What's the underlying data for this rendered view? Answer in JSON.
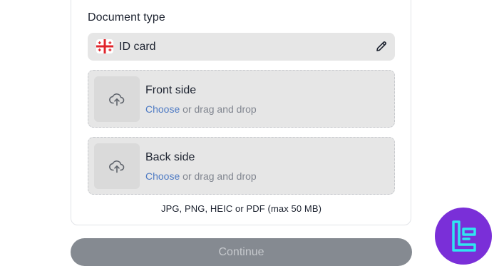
{
  "document": {
    "section_title": "Document type",
    "selected_type": "ID card",
    "flag_icon": "georgia-flag-icon",
    "edit_icon": "pencil-icon"
  },
  "upload": {
    "front": {
      "title": "Front side",
      "choose_label": "Choose",
      "drag_label": " or drag and drop",
      "icon": "cloud-upload-icon"
    },
    "back": {
      "title": "Back side",
      "choose_label": "Choose",
      "drag_label": " or drag and drop",
      "icon": "cloud-upload-icon"
    },
    "formats_note": "JPG, PNG, HEIC or PDF (max 50 MB)"
  },
  "actions": {
    "continue_label": "Continue"
  },
  "colors": {
    "accent_link": "#4f7bc4",
    "button_disabled_bg": "#858a91",
    "button_disabled_text": "#c6c9cd",
    "dropzone_bg": "#e6e6e6",
    "logo_purple": "#7a2fd8",
    "logo_cyan": "#2fe6f0"
  }
}
